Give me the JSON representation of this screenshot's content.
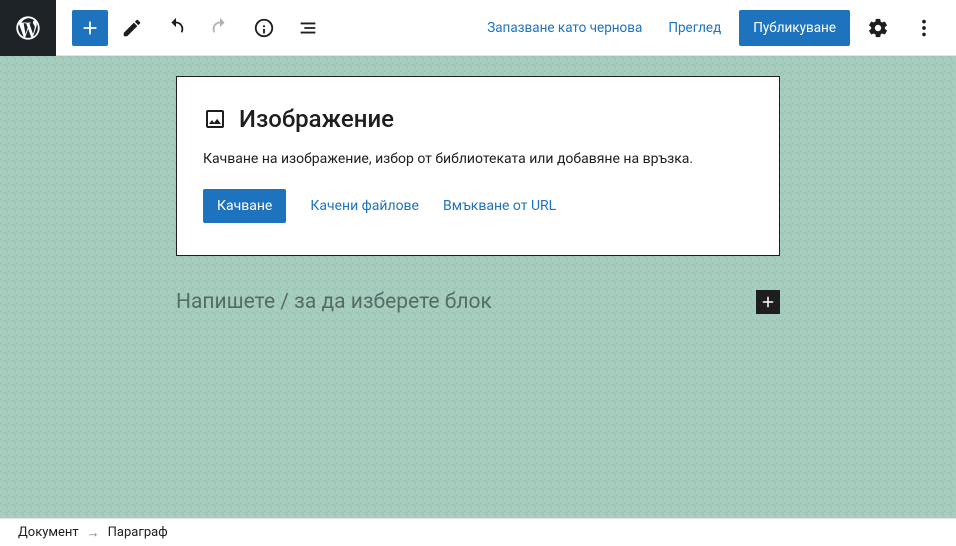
{
  "toolbar": {
    "save_draft": "Запазване като чернова",
    "preview": "Преглед",
    "publish": "Публикуване"
  },
  "image_block": {
    "title": "Изображение",
    "description": "Качване на изображение, избор от библиотеката или добавяне на връзка.",
    "upload": "Качване",
    "media_library": "Качени файлове",
    "insert_url": "Вмъкване от URL"
  },
  "paragraph": {
    "placeholder": "Напишете / за да изберете блок"
  },
  "breadcrumb": {
    "root": "Документ",
    "current": "Параграф"
  }
}
